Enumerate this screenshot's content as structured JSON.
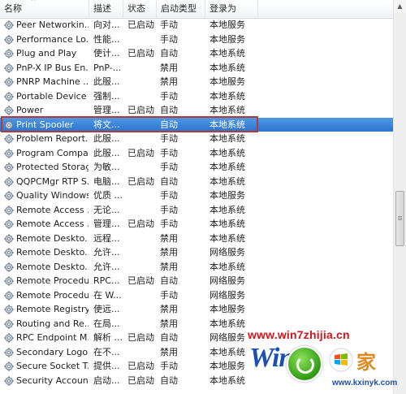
{
  "columns": [
    {
      "key": "name",
      "label": "名称"
    },
    {
      "key": "desc",
      "label": "描述"
    },
    {
      "key": "status",
      "label": "状态"
    },
    {
      "key": "startup",
      "label": "启动类型"
    },
    {
      "key": "logon",
      "label": "登录为"
    }
  ],
  "sort_indicator": "^",
  "rows": [
    {
      "name": "Peer Networkin...",
      "desc": "向对...",
      "status": "已启动",
      "startup": "手动",
      "logon": "本地服务"
    },
    {
      "name": "Performance Lo...",
      "desc": "性能...",
      "status": "",
      "startup": "手动",
      "logon": "本地服务"
    },
    {
      "name": "Plug and Play",
      "desc": "使计...",
      "status": "已启动",
      "startup": "自动",
      "logon": "本地系统"
    },
    {
      "name": "PnP-X IP Bus En...",
      "desc": "PnP-...",
      "status": "",
      "startup": "禁用",
      "logon": "本地系统"
    },
    {
      "name": "PNRP Machine ...",
      "desc": "此服...",
      "status": "",
      "startup": "禁用",
      "logon": "本地服务"
    },
    {
      "name": "Portable Device ...",
      "desc": "强制...",
      "status": "",
      "startup": "手动",
      "logon": "本地系统"
    },
    {
      "name": "Power",
      "desc": "管理...",
      "status": "已启动",
      "startup": "自动",
      "logon": "本地系统"
    },
    {
      "name": "Print Spooler",
      "desc": "将文...",
      "status": "",
      "startup": "自动",
      "logon": "本地系统",
      "selected": true
    },
    {
      "name": "Problem Report...",
      "desc": "此服...",
      "status": "",
      "startup": "手动",
      "logon": "本地系统"
    },
    {
      "name": "Program Compa...",
      "desc": "此服...",
      "status": "已启动",
      "startup": "手动",
      "logon": "本地系统"
    },
    {
      "name": "Protected Storage",
      "desc": "为敏...",
      "status": "",
      "startup": "手动",
      "logon": "本地系统"
    },
    {
      "name": "QQPCMgr RTP S...",
      "desc": "电脑...",
      "status": "已启动",
      "startup": "自动",
      "logon": "本地系统"
    },
    {
      "name": "Quality Windows...",
      "desc": "优质 ...",
      "status": "",
      "startup": "手动",
      "logon": "本地服务"
    },
    {
      "name": "Remote Access ...",
      "desc": "无论...",
      "status": "",
      "startup": "手动",
      "logon": "本地系统"
    },
    {
      "name": "Remote Access ...",
      "desc": "管理...",
      "status": "已启动",
      "startup": "手动",
      "logon": "本地系统"
    },
    {
      "name": "Remote Deskto...",
      "desc": "远程...",
      "status": "",
      "startup": "禁用",
      "logon": "本地系统"
    },
    {
      "name": "Remote Deskto...",
      "desc": "允许...",
      "status": "",
      "startup": "禁用",
      "logon": "网络服务"
    },
    {
      "name": "Remote Deskto...",
      "desc": "允许...",
      "status": "",
      "startup": "禁用",
      "logon": "本地系统"
    },
    {
      "name": "Remote Procedu...",
      "desc": "RPC...",
      "status": "已启动",
      "startup": "自动",
      "logon": "网络服务"
    },
    {
      "name": "Remote Procedu...",
      "desc": "在 W...",
      "status": "",
      "startup": "手动",
      "logon": "网络服务"
    },
    {
      "name": "Remote Registry",
      "desc": "使远...",
      "status": "",
      "startup": "禁用",
      "logon": "本地服务"
    },
    {
      "name": "Routing and Re...",
      "desc": "在局...",
      "status": "",
      "startup": "禁用",
      "logon": "本地系统"
    },
    {
      "name": "RPC Endpoint M...",
      "desc": "解析 ...",
      "status": "已启动",
      "startup": "自动",
      "logon": "网络服务"
    },
    {
      "name": "Secondary Logon",
      "desc": "在不...",
      "status": "",
      "startup": "禁用",
      "logon": "本地系统"
    },
    {
      "name": "Secure Socket T...",
      "desc": "提供...",
      "status": "已启动",
      "startup": "手动",
      "logon": "本地服务"
    },
    {
      "name": "Security Account...",
      "desc": "启动...",
      "status": "已启动",
      "startup": "自动",
      "logon": "本地系统"
    },
    {
      "name": "",
      "desc": "",
      "status": "",
      "startup": "",
      "logon": ""
    }
  ],
  "watermark": {
    "url_top": "www.win7zhijia.cn",
    "brand": "Win7",
    "cn_text": "家",
    "url_bottom": "www.kxinyk.com"
  },
  "colors": {
    "selection": "#3a83d8",
    "highlight_box": "#b33a3a",
    "watermark_red": "#d4131a"
  }
}
